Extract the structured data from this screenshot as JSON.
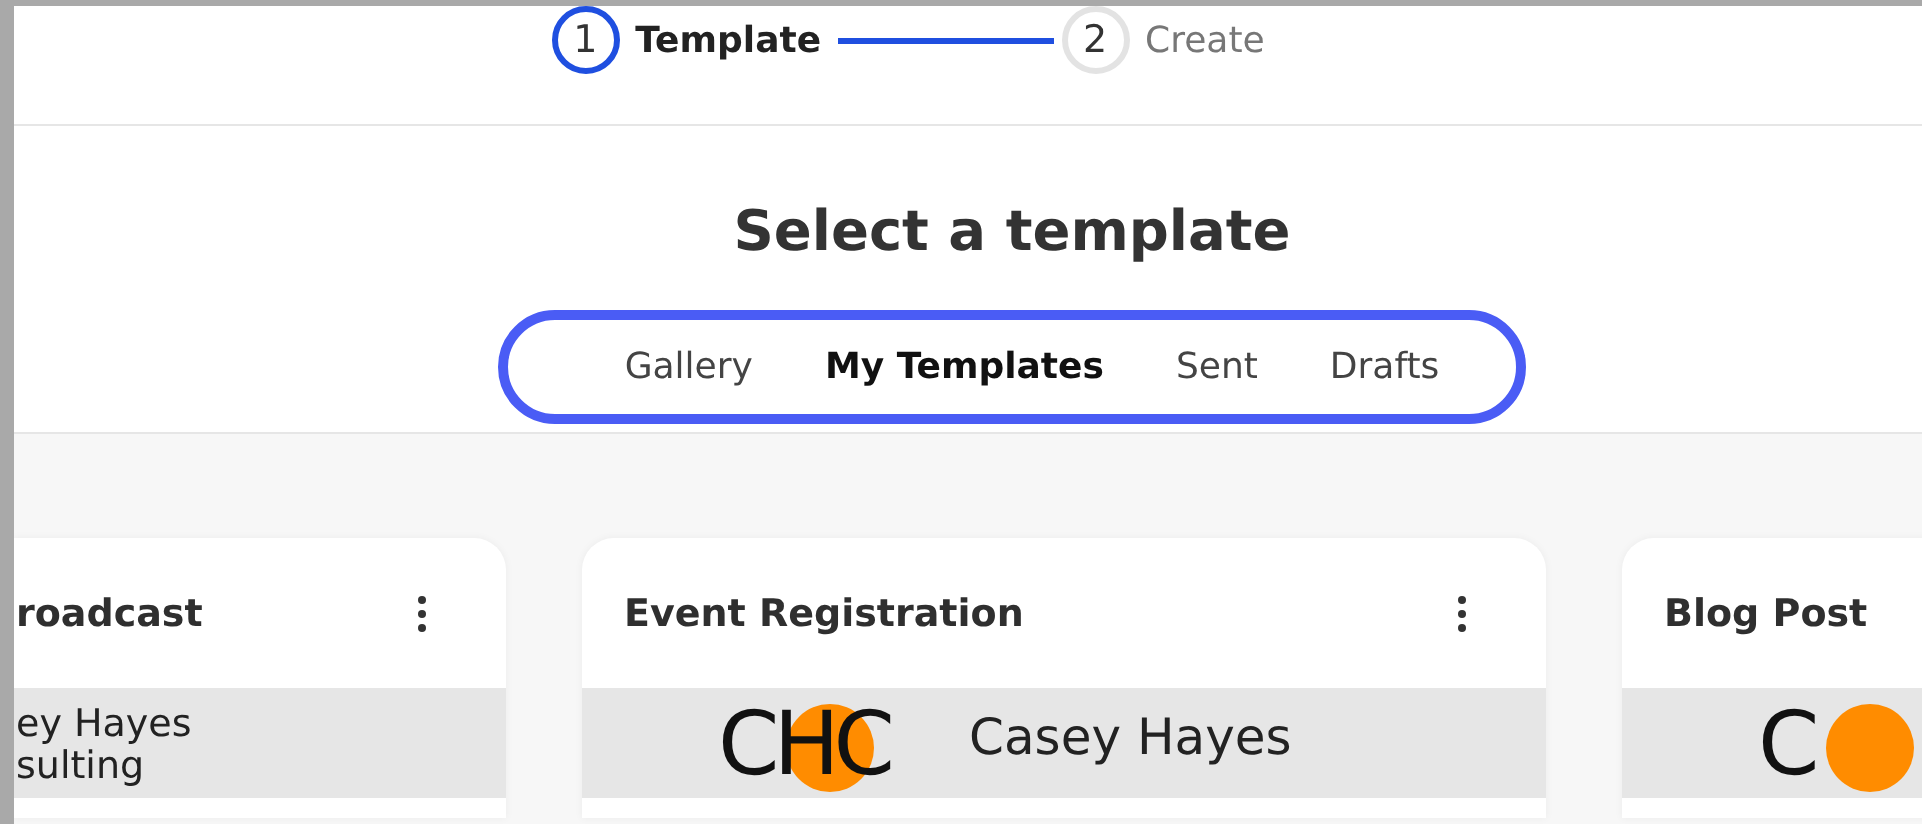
{
  "stepper": {
    "steps": [
      {
        "number": "1",
        "label": "Template",
        "selected": true
      },
      {
        "number": "2",
        "label": "Create",
        "selected": false
      }
    ]
  },
  "title": "Select a template",
  "tabs": [
    {
      "label": "Gallery",
      "selected": false
    },
    {
      "label": "My Templates",
      "selected": true
    },
    {
      "label": "Sent",
      "selected": false
    },
    {
      "label": "Drafts",
      "selected": false
    }
  ],
  "cards": [
    {
      "title": "roadcast",
      "has_menu": true,
      "preview": {
        "kind": "text",
        "lines": [
          "ey Hayes",
          "sulting"
        ]
      }
    },
    {
      "title": "Event Registration",
      "has_menu": true,
      "preview": {
        "kind": "logo",
        "logo": "CHC",
        "name": "Casey Hayes"
      }
    },
    {
      "title": "Blog Post",
      "preview": {
        "kind": "logo",
        "logo": "C"
      }
    }
  ]
}
